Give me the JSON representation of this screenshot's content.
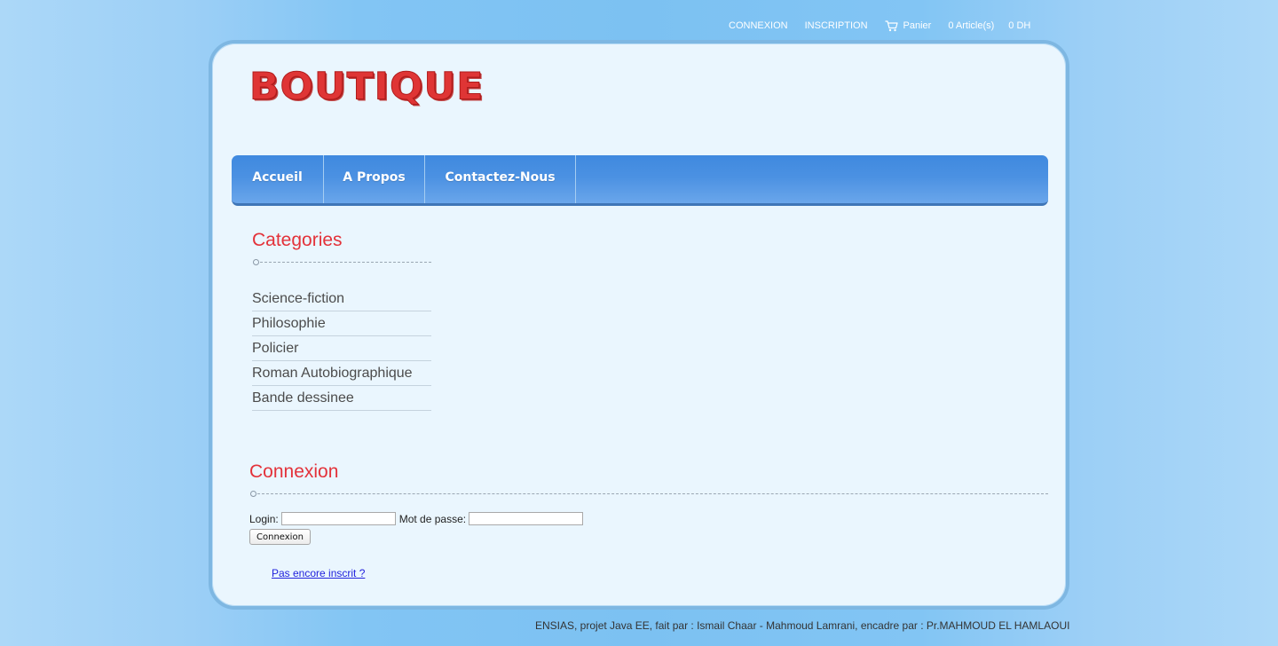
{
  "topbar": {
    "connexion": "CONNEXION",
    "inscription": "INSCRIPTION",
    "cart_icon": "cart-icon",
    "panier": "Panier",
    "articles": "0 Article(s)",
    "total": "0 DH"
  },
  "logo": {
    "text": "BOUTIQUE"
  },
  "nav": {
    "items": [
      {
        "label": "Accueil"
      },
      {
        "label": "A Propos"
      },
      {
        "label": "Contactez-Nous"
      }
    ]
  },
  "categories": {
    "title": "Categories",
    "items": [
      "Science-fiction",
      "Philosophie",
      "Policier",
      "Roman Autobiographique",
      "Bande dessinee"
    ]
  },
  "connexion": {
    "title": "Connexion",
    "login_label": "Login:",
    "login_value": "",
    "password_label": "Mot de passe:",
    "password_value": "",
    "submit_label": "Connexion",
    "register_link": "Pas encore inscrit ?"
  },
  "footer": {
    "text": "ENSIAS, projet Java EE, fait par : Ismail Chaar - Mahmoud Lamrani, encadre par : Pr.MAHMOUD EL HAMLAOUI"
  },
  "colors": {
    "accent_red": "#e3323a",
    "nav_blue": "#4b91e2",
    "container_bg": "#eaf6fe"
  }
}
